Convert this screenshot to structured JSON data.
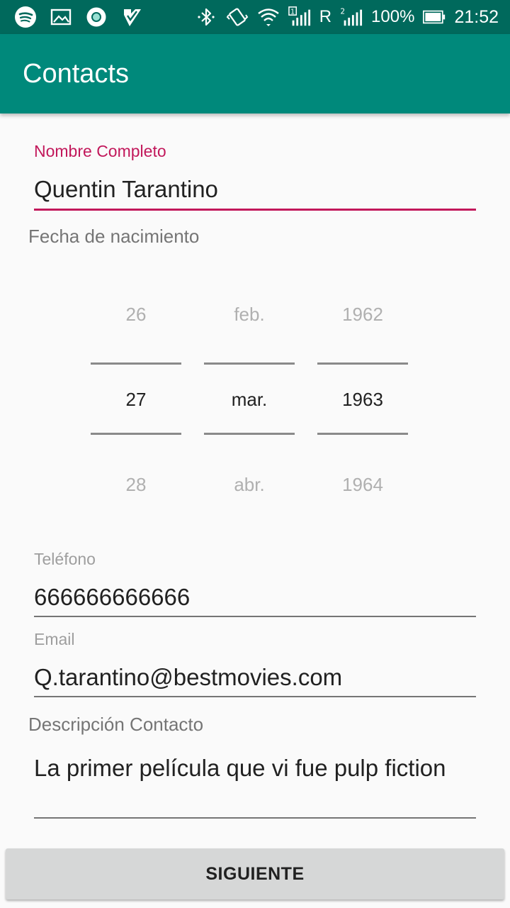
{
  "status_bar": {
    "left_icons": [
      "spotify-icon",
      "image-icon",
      "circle-app-icon",
      "check-app-icon"
    ],
    "right_icons": [
      "bluetooth-icon",
      "vibrate-icon",
      "wifi-icon",
      "signal-sim1-icon",
      "signal-sim2-icon",
      "battery-icon"
    ],
    "roaming": "R",
    "battery": "100%",
    "time": "21:52"
  },
  "app_bar": {
    "title": "Contacts"
  },
  "form": {
    "name": {
      "label": "Nombre Completo",
      "value": "Quentin Tarantino"
    },
    "birthdate": {
      "label": "Fecha de nacimiento",
      "day": {
        "prev": "26",
        "selected": "27",
        "next": "28"
      },
      "month": {
        "prev": "feb.",
        "selected": "mar.",
        "next": "abr."
      },
      "year": {
        "prev": "1962",
        "selected": "1963",
        "next": "1964"
      }
    },
    "phone": {
      "label": "Teléfono",
      "value": "666666666666"
    },
    "email": {
      "label": "Email",
      "value": "Q.tarantino@bestmovies.com"
    },
    "description": {
      "label": "Descripción Contacto",
      "value": "La primer película que vi fue pulp fiction"
    }
  },
  "actions": {
    "next_label": "SIGUIENTE"
  },
  "colors": {
    "status_bar": "#00695c",
    "app_bar": "#00897b",
    "accent": "#c2185b",
    "button": "#d6d7d7"
  }
}
